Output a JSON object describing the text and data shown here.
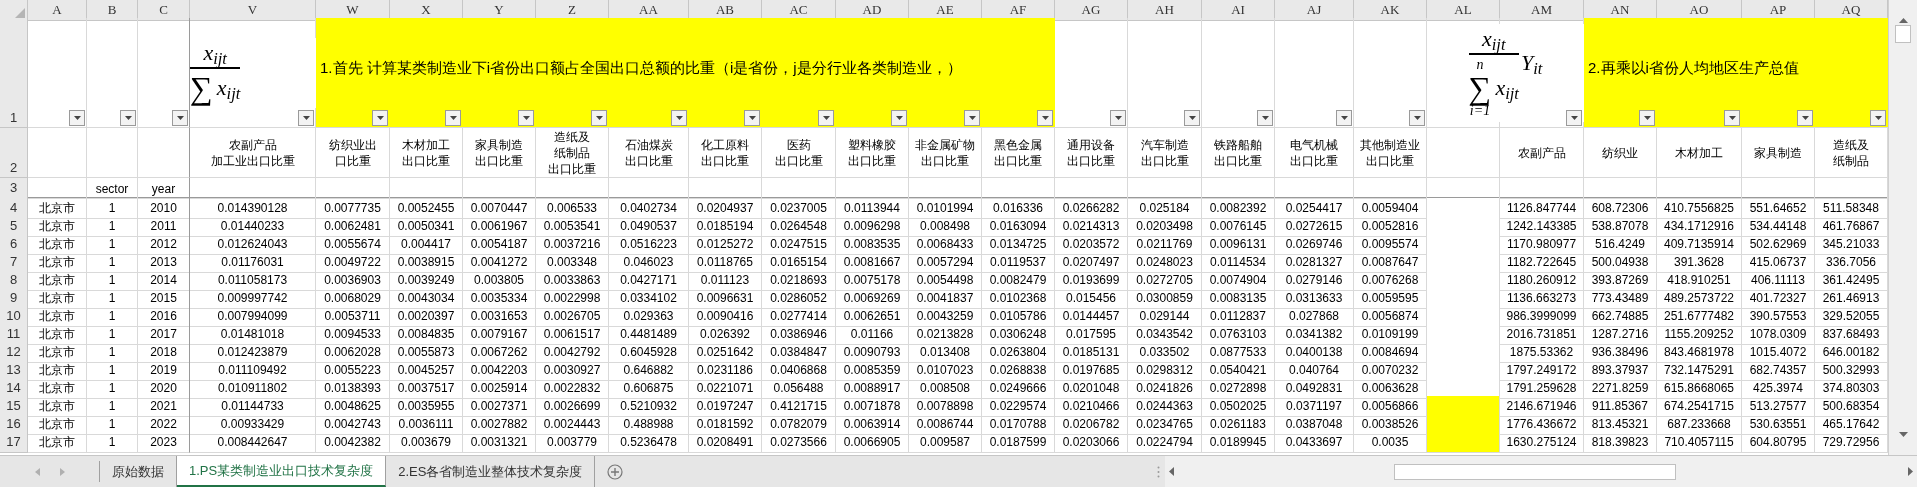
{
  "columns": [
    {
      "letter": "A",
      "filter": true
    },
    {
      "letter": "B",
      "filter": true,
      "sublabel": "sector"
    },
    {
      "letter": "C",
      "filter": true,
      "sublabel": "year"
    },
    {
      "letter": "V",
      "filter": true,
      "label": [
        "农副产品",
        "加工业出口比重"
      ]
    },
    {
      "letter": "W",
      "filter": true,
      "label": [
        "纺织业出",
        "口比重"
      ]
    },
    {
      "letter": "X",
      "filter": true,
      "label": [
        "木材加工",
        "出口比重"
      ]
    },
    {
      "letter": "Y",
      "filter": true,
      "label": [
        "家具制造",
        "出口比重"
      ]
    },
    {
      "letter": "Z",
      "filter": true,
      "label": [
        "造纸及",
        "纸制品",
        "出口比重"
      ]
    },
    {
      "letter": "AA",
      "filter": true,
      "label": [
        "石油煤炭",
        "出口比重"
      ]
    },
    {
      "letter": "AB",
      "filter": true,
      "label": [
        "化工原料",
        "出口比重"
      ]
    },
    {
      "letter": "AC",
      "filter": true,
      "label": [
        "医药",
        "出口比重"
      ]
    },
    {
      "letter": "AD",
      "filter": true,
      "label": [
        "塑料橡胶",
        "出口比重"
      ]
    },
    {
      "letter": "AE",
      "filter": true,
      "label": [
        "非金属矿物",
        "出口比重"
      ]
    },
    {
      "letter": "AF",
      "filter": true,
      "label": [
        "黑色金属",
        "出口比重"
      ]
    },
    {
      "letter": "AG",
      "filter": true,
      "label": [
        "通用设备",
        "出口比重"
      ]
    },
    {
      "letter": "AH",
      "filter": true,
      "label": [
        "汽车制造",
        "出口比重"
      ]
    },
    {
      "letter": "AI",
      "filter": true,
      "label": [
        "铁路船舶",
        "出口比重"
      ]
    },
    {
      "letter": "AJ",
      "filter": true,
      "label": [
        "电气机械",
        "出口比重"
      ]
    },
    {
      "letter": "AK",
      "filter": true,
      "label": [
        "其他制造业",
        "出口比重"
      ]
    },
    {
      "letter": "AL",
      "filter": false
    },
    {
      "letter": "AM",
      "filter": true,
      "label": [
        "农副产品"
      ]
    },
    {
      "letter": "AN",
      "filter": true,
      "label": [
        "纺织业"
      ]
    },
    {
      "letter": "AO",
      "filter": true,
      "label": [
        "木材加工"
      ]
    },
    {
      "letter": "AP",
      "filter": true,
      "label": [
        "家具制造"
      ]
    },
    {
      "letter": "AQ",
      "filter": true,
      "label": [
        "造纸及",
        "纸制品"
      ]
    }
  ],
  "header_rows": [
    "1",
    "2",
    "3"
  ],
  "banners": [
    {
      "text": "1.首先 计算某类制造业下i省份出口额占全国出口总额的比重（i是省份，j是分行业各类制造业，）"
    },
    {
      "text": "2.再乘以i省份人均地区生产总值"
    }
  ],
  "formulas": [
    {
      "numerator": "x$_{ijt}$",
      "sigma": "∑",
      "denominator": "x$_{ijt}$"
    },
    {
      "numerator": "x$_{ijt}$",
      "factor": "Y$_{it}$",
      "upper": "n",
      "sigma": "∑",
      "lower": "i=1",
      "denominator": "x$_{ijt}$"
    }
  ],
  "rows": [
    {
      "number": "4",
      "marked": false,
      "cells": [
        "北京市",
        "1",
        "2010",
        "0.014390128",
        "0.0077735",
        "0.0052455",
        "0.0070447",
        "0.006533",
        "0.0402734",
        "0.0204937",
        "0.0237005",
        "0.0113944",
        "0.0101994",
        "0.016336",
        "0.0266282",
        "0.025184",
        "0.0082392",
        "0.0254417",
        "0.0059404",
        "1126.847744",
        "608.72306",
        "410.7556825",
        "551.64652",
        "511.58348"
      ]
    },
    {
      "number": "5",
      "marked": false,
      "cells": [
        "北京市",
        "1",
        "2011",
        "0.01440233",
        "0.0062481",
        "0.0050341",
        "0.0061967",
        "0.0053541",
        "0.0490537",
        "0.0185194",
        "0.0264548",
        "0.0096298",
        "0.008498",
        "0.0163094",
        "0.0214313",
        "0.0203498",
        "0.0076145",
        "0.0272615",
        "0.0052816",
        "1242.143385",
        "538.87078",
        "434.1712916",
        "534.44148",
        "461.76867"
      ]
    },
    {
      "number": "6",
      "marked": false,
      "cells": [
        "北京市",
        "1",
        "2012",
        "0.012624043",
        "0.0055674",
        "0.004417",
        "0.0054187",
        "0.0037216",
        "0.0516223",
        "0.0125272",
        "0.0247515",
        "0.0083535",
        "0.0068433",
        "0.0134725",
        "0.0203572",
        "0.0211769",
        "0.0096131",
        "0.0269746",
        "0.0095574",
        "1170.980977",
        "516.4249",
        "409.7135914",
        "502.62969",
        "345.21033"
      ]
    },
    {
      "number": "7",
      "marked": false,
      "cells": [
        "北京市",
        "1",
        "2013",
        "0.01176031",
        "0.0049722",
        "0.0038915",
        "0.0041272",
        "0.003348",
        "0.046023",
        "0.0118765",
        "0.0165154",
        "0.0081667",
        "0.0057294",
        "0.0119537",
        "0.0207497",
        "0.0248023",
        "0.0114534",
        "0.0281327",
        "0.0087647",
        "1182.722645",
        "500.04938",
        "391.3628",
        "415.06737",
        "336.7056"
      ]
    },
    {
      "number": "8",
      "marked": false,
      "cells": [
        "北京市",
        "1",
        "2014",
        "0.011058173",
        "0.0036903",
        "0.0039249",
        "0.003805",
        "0.0033863",
        "0.0427171",
        "0.011123",
        "0.0218693",
        "0.0075178",
        "0.0054498",
        "0.0082479",
        "0.0193699",
        "0.0272705",
        "0.0074904",
        "0.0279146",
        "0.0076268",
        "1180.260912",
        "393.87269",
        "418.910251",
        "406.11113",
        "361.42495"
      ]
    },
    {
      "number": "9",
      "marked": false,
      "cells": [
        "北京市",
        "1",
        "2015",
        "0.009997742",
        "0.0068029",
        "0.0043034",
        "0.0035334",
        "0.0022998",
        "0.0334102",
        "0.0096631",
        "0.0286052",
        "0.0069269",
        "0.0041837",
        "0.0102368",
        "0.015456",
        "0.0300859",
        "0.0083135",
        "0.0313633",
        "0.0059595",
        "1136.663273",
        "773.43489",
        "489.2573722",
        "401.72327",
        "261.46913"
      ]
    },
    {
      "number": "10",
      "marked": false,
      "cells": [
        "北京市",
        "1",
        "2016",
        "0.007994099",
        "0.0053711",
        "0.0020397",
        "0.0031653",
        "0.0026705",
        "0.029363",
        "0.0090416",
        "0.0277414",
        "0.0062651",
        "0.0043259",
        "0.0105786",
        "0.0144457",
        "0.029144",
        "0.0112837",
        "0.027868",
        "0.0056874",
        "986.3999099",
        "662.74885",
        "251.6777482",
        "390.57553",
        "329.52055"
      ]
    },
    {
      "number": "11",
      "marked": false,
      "cells": [
        "北京市",
        "1",
        "2017",
        "0.01481018",
        "0.0094533",
        "0.0084835",
        "0.0079167",
        "0.0061517",
        "0.4481489",
        "0.026392",
        "0.0386946",
        "0.01166",
        "0.0213828",
        "0.0306248",
        "0.017595",
        "0.0343542",
        "0.0763103",
        "0.0341382",
        "0.0109199",
        "2016.731851",
        "1287.2716",
        "1155.209252",
        "1078.0309",
        "837.68493"
      ]
    },
    {
      "number": "12",
      "marked": false,
      "cells": [
        "北京市",
        "1",
        "2018",
        "0.012423879",
        "0.0062028",
        "0.0055873",
        "0.0067262",
        "0.0042792",
        "0.6045928",
        "0.0251642",
        "0.0384847",
        "0.0090793",
        "0.013408",
        "0.0263804",
        "0.0185131",
        "0.033502",
        "0.0877533",
        "0.0400138",
        "0.0084694",
        "1875.53362",
        "936.38496",
        "843.4681978",
        "1015.4072",
        "646.00182"
      ]
    },
    {
      "number": "13",
      "marked": false,
      "cells": [
        "北京市",
        "1",
        "2019",
        "0.011109492",
        "0.0055223",
        "0.0045257",
        "0.0042203",
        "0.0030927",
        "0.646882",
        "0.0231186",
        "0.0406868",
        "0.0085359",
        "0.0107023",
        "0.0268838",
        "0.0197685",
        "0.0298312",
        "0.0540421",
        "0.040764",
        "0.0070232",
        "1797.249172",
        "893.37937",
        "732.1475291",
        "682.74357",
        "500.32993"
      ]
    },
    {
      "number": "14",
      "marked": false,
      "cells": [
        "北京市",
        "1",
        "2020",
        "0.010911802",
        "0.0138393",
        "0.0037517",
        "0.0025914",
        "0.0022832",
        "0.606875",
        "0.0221071",
        "0.056488",
        "0.0088917",
        "0.008508",
        "0.0249666",
        "0.0201048",
        "0.0241826",
        "0.0272898",
        "0.0492831",
        "0.0063628",
        "1791.259628",
        "2271.8259",
        "615.8668065",
        "425.3974",
        "374.80303"
      ]
    },
    {
      "number": "15",
      "marked": true,
      "cells": [
        "北京市",
        "1",
        "2021",
        "0.01144733",
        "0.0048625",
        "0.0035955",
        "0.0027371",
        "0.0026699",
        "0.5210932",
        "0.0197247",
        "0.4121715",
        "0.0071878",
        "0.0078898",
        "0.0229574",
        "0.0210466",
        "0.0244363",
        "0.0502025",
        "0.0371197",
        "0.0056866",
        "2146.671946",
        "911.85367",
        "674.2541715",
        "513.27577",
        "500.68354"
      ]
    },
    {
      "number": "16",
      "marked": true,
      "cells": [
        "北京市",
        "1",
        "2022",
        "0.00933429",
        "0.0042743",
        "0.0036111",
        "0.0027882",
        "0.0024443",
        "0.488988",
        "0.0181592",
        "0.0782079",
        "0.0063914",
        "0.0086744",
        "0.0170788",
        "0.0206782",
        "0.0234765",
        "0.0261183",
        "0.0387048",
        "0.0038526",
        "1776.436672",
        "813.45321",
        "687.233668",
        "530.63551",
        "465.17642"
      ]
    },
    {
      "number": "17",
      "marked": true,
      "cells": [
        "北京市",
        "1",
        "2023",
        "0.008442647",
        "0.0042382",
        "0.003679",
        "0.0031321",
        "0.003779",
        "0.5236478",
        "0.0208491",
        "0.0273566",
        "0.0066905",
        "0.009587",
        "0.0187599",
        "0.0203066",
        "0.0224794",
        "0.0189945",
        "0.0433697",
        "0.0035",
        "1630.275124",
        "818.39823",
        "710.4057115",
        "604.80795",
        "729.72956"
      ]
    }
  ],
  "sheet_tabs": [
    {
      "label": "原始数据",
      "selected": false
    },
    {
      "label": "1.PS某类制造业出口技术复杂度",
      "selected": true
    },
    {
      "label": "2.ES各省制造业整体技术复杂度",
      "selected": false
    }
  ]
}
